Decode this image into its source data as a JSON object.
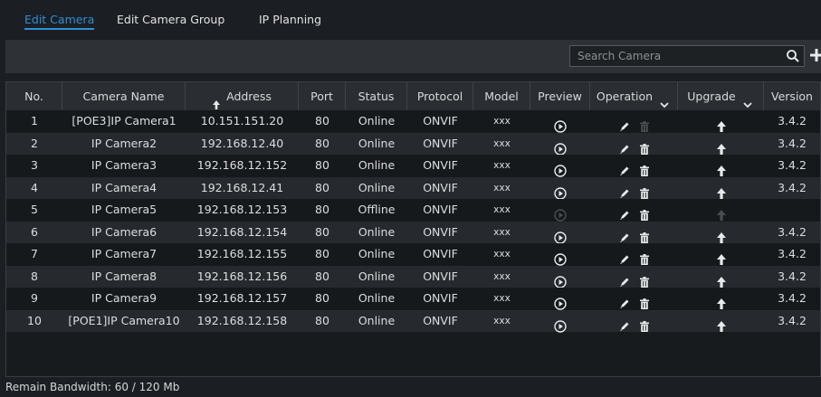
{
  "tabs": [
    {
      "label": "Edit Camera",
      "active": true
    },
    {
      "label": "Edit Camera Group",
      "active": false
    },
    {
      "label": "IP Planning",
      "active": false
    }
  ],
  "search": {
    "placeholder": "Search Camera",
    "value": ""
  },
  "table": {
    "headers": {
      "no": "No.",
      "camera_name": "Camera Name",
      "address": "Address",
      "port": "Port",
      "status": "Status",
      "protocol": "Protocol",
      "model": "Model",
      "preview": "Preview",
      "operation": "Operation",
      "upgrade": "Upgrade",
      "version": "Version"
    },
    "rows": [
      {
        "no": "1",
        "name": "[POE3]IP Camera1",
        "address": "10.151.151.20",
        "port": "80",
        "status": "Online",
        "protocol": "ONVIF",
        "model": "xxx",
        "version": "3.4.2",
        "online": true,
        "delete_enabled": false
      },
      {
        "no": "2",
        "name": "IP Camera2",
        "address": "192.168.12.40",
        "port": "80",
        "status": "Online",
        "protocol": "ONVIF",
        "model": "xxx",
        "version": "3.4.2",
        "online": true,
        "delete_enabled": true
      },
      {
        "no": "3",
        "name": "IP Camera3",
        "address": "192.168.12.152",
        "port": "80",
        "status": "Online",
        "protocol": "ONVIF",
        "model": "xxx",
        "version": "3.4.2",
        "online": true,
        "delete_enabled": true
      },
      {
        "no": "4",
        "name": "IP Camera4",
        "address": "192.168.12.41",
        "port": "80",
        "status": "Online",
        "protocol": "ONVIF",
        "model": "xxx",
        "version": "3.4.2",
        "online": true,
        "delete_enabled": true
      },
      {
        "no": "5",
        "name": "IP Camera5",
        "address": "192.168.12.153",
        "port": "80",
        "status": "Offline",
        "protocol": "ONVIF",
        "model": "xxx",
        "version": "",
        "online": false,
        "delete_enabled": true
      },
      {
        "no": "6",
        "name": "IP Camera6",
        "address": "192.168.12.154",
        "port": "80",
        "status": "Online",
        "protocol": "ONVIF",
        "model": "xxx",
        "version": "3.4.2",
        "online": true,
        "delete_enabled": true
      },
      {
        "no": "7",
        "name": "IP Camera7",
        "address": "192.168.12.155",
        "port": "80",
        "status": "Online",
        "protocol": "ONVIF",
        "model": "xxx",
        "version": "3.4.2",
        "online": true,
        "delete_enabled": true
      },
      {
        "no": "8",
        "name": "IP Camera8",
        "address": "192.168.12.156",
        "port": "80",
        "status": "Online",
        "protocol": "ONVIF",
        "model": "xxx",
        "version": "3.4.2",
        "online": true,
        "delete_enabled": true
      },
      {
        "no": "9",
        "name": "IP Camera9",
        "address": "192.168.12.157",
        "port": "80",
        "status": "Online",
        "protocol": "ONVIF",
        "model": "xxx",
        "version": "3.4.2",
        "online": true,
        "delete_enabled": true
      },
      {
        "no": "10",
        "name": "[POE1]IP Camera10",
        "address": "192.168.12.158",
        "port": "80",
        "status": "Online",
        "protocol": "ONVIF",
        "model": "xxx",
        "version": "3.4.2",
        "online": true,
        "delete_enabled": true
      }
    ]
  },
  "footer": {
    "bandwidth": "Remain Bandwidth: 60 / 120 Mb"
  },
  "colors": {
    "accent": "#2f8fd6",
    "background": "#1b1e22",
    "toolbar": "#2e3135",
    "header": "#2a2d31"
  },
  "icons": {
    "search": "search-icon",
    "add": "plus-icon",
    "sort": "sort-arrow-icon",
    "dropdown": "chevron-down-icon",
    "preview": "play-circle-icon",
    "edit": "pencil-icon",
    "delete": "trash-icon",
    "upgrade": "arrow-up-icon"
  }
}
